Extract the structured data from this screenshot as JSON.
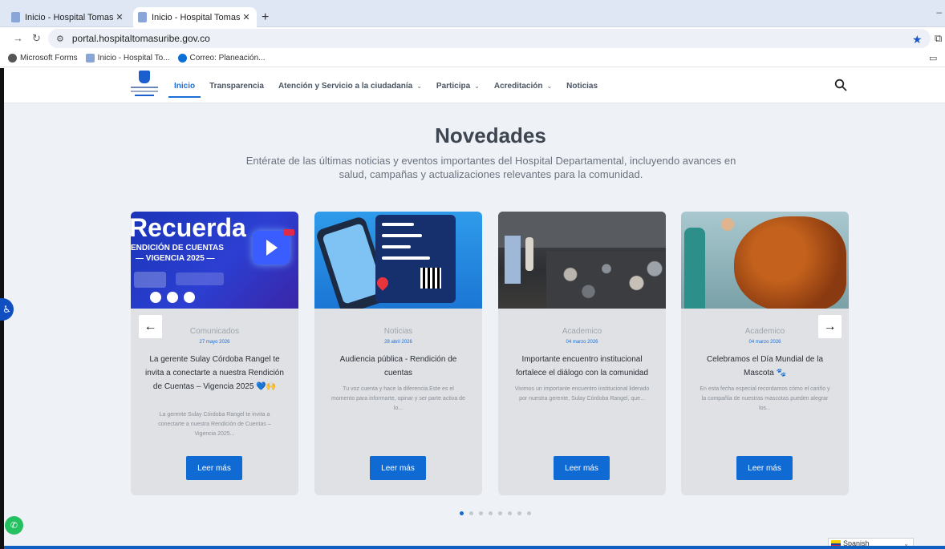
{
  "browser": {
    "tabs": [
      {
        "title": "Inicio - Hospital Tomas Uribe U",
        "close": "✕"
      },
      {
        "title": "Inicio - Hospital Tomas Uribe U",
        "close": "✕"
      }
    ],
    "new_tab": "+",
    "url": "portal.hospitaltomasuribe.gov.co",
    "bookmarks": [
      "Microsoft Forms",
      "Inicio - Hospital To...",
      "Correo: Planeación..."
    ]
  },
  "nav": {
    "items": [
      {
        "label": "Inicio",
        "active": true,
        "caret": false
      },
      {
        "label": "Transparencia",
        "caret": false
      },
      {
        "label": "Atención y Servicio a la ciudadanía",
        "caret": true
      },
      {
        "label": "Participa",
        "caret": true
      },
      {
        "label": "Acreditación",
        "caret": true
      },
      {
        "label": "Noticias",
        "caret": false
      }
    ]
  },
  "section": {
    "title": "Novedades",
    "subtitle": "Entérate de las últimas noticias y eventos importantes del Hospital Departamental, incluyendo avances en salud, campañas y actualizaciones relevantes para la comunidad."
  },
  "cards": [
    {
      "category": "Comunicados",
      "date": "27 mayo 2026",
      "headline": "La gerente Sulay Córdoba Rangel te invita a conectarte a nuestra Rendición de Cuentas – Vigencia 2025 💙🙌",
      "excerpt": "La gerente Sulay Córdoba Rangel te invita a conectarte a nuestra Rendición de Cuentas – Vigencia 2025...",
      "button": "Leer más",
      "image_text": {
        "line1": "Recuerda",
        "line2": "ENDICIÓN DE CUENTAS",
        "line3": "— VIGENCIA 2025 —"
      }
    },
    {
      "category": "Noticias",
      "date": "28 abril 2026",
      "headline": "Audiencia pública - Rendición de cuentas",
      "excerpt": "Tu voz cuenta y hace la diferencia.Este es el momento para informarte, opinar y ser parte activa de lo...",
      "button": "Leer más"
    },
    {
      "category": "Academico",
      "date": "04 marzo 2026",
      "headline": "Importante encuentro institucional fortalece el diálogo con la comunidad",
      "excerpt": "Vivimos un importante encuentro institucional liderado por nuestra gerente, Sulay Córdoba Rangel, que...",
      "button": "Leer más"
    },
    {
      "category": "Academico",
      "date": "04 marzo 2026",
      "headline": "Celebramos el Día Mundial de la Mascota 🐾",
      "excerpt": "En esta fecha especial recordamos cómo el cariño y la compañía de nuestras mascotas pueden alegrar los...",
      "button": "Leer más"
    }
  ],
  "carousel": {
    "prev": "←",
    "next": "→",
    "dots": 8,
    "active_dot": 0
  },
  "language": {
    "selected": "Spanish"
  },
  "colors": {
    "primary": "#0f6bd3",
    "background": "#eef1f5",
    "card": "#dfe1e4"
  }
}
